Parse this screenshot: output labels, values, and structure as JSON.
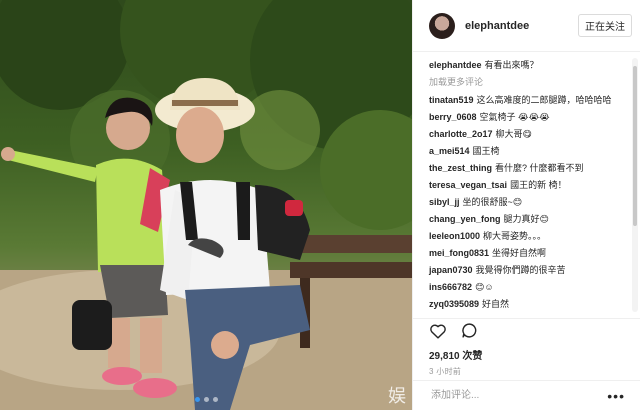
{
  "header": {
    "username": "elephantdee",
    "follow_label": "正在关注"
  },
  "caption": {
    "user": "elephantdee",
    "text": "有看出來嗎？"
  },
  "load_more": "加载更多评论",
  "comments": [
    {
      "user": "tinatan519",
      "text": "这么高难度的二郎腿蹲，哈哈哈哈"
    },
    {
      "user": "berry_0608",
      "text": "空氣椅子 😭😭😭"
    },
    {
      "user": "charlotte_2o17",
      "text": "柳大哥😋"
    },
    {
      "user": "a_mei514",
      "text": "國王椅"
    },
    {
      "user": "the_zest_thing",
      "text": "看什麼? 什麼都看不到"
    },
    {
      "user": "teresa_vegan_tsai",
      "text": "國王的新 椅！"
    },
    {
      "user": "sibyl_jj",
      "text": "坐的很舒服~😊"
    },
    {
      "user": "chang_yen_fong",
      "text": "腿力真好😊"
    },
    {
      "user": "leeleon1000",
      "text": "柳大哥姿势。。。"
    },
    {
      "user": "mei_fong0831",
      "text": "坐得好自然啊"
    },
    {
      "user": "japan0730",
      "text": "我覺得你們蹲的很辛苦"
    },
    {
      "user": "ins666782",
      "text": "😊☺"
    },
    {
      "user": "zyq0395089",
      "text": "好自然"
    }
  ],
  "likes": "29,810 次赞",
  "time": "3 小时前",
  "add_comment_placeholder": "添加评论...",
  "more_options": "•••",
  "watermark": "娱",
  "colors": {
    "accent_blue": "#3897f0",
    "text": "#262626",
    "muted": "#999999",
    "border": "#efefef"
  },
  "icons": [
    "heart-icon",
    "comment-icon"
  ]
}
